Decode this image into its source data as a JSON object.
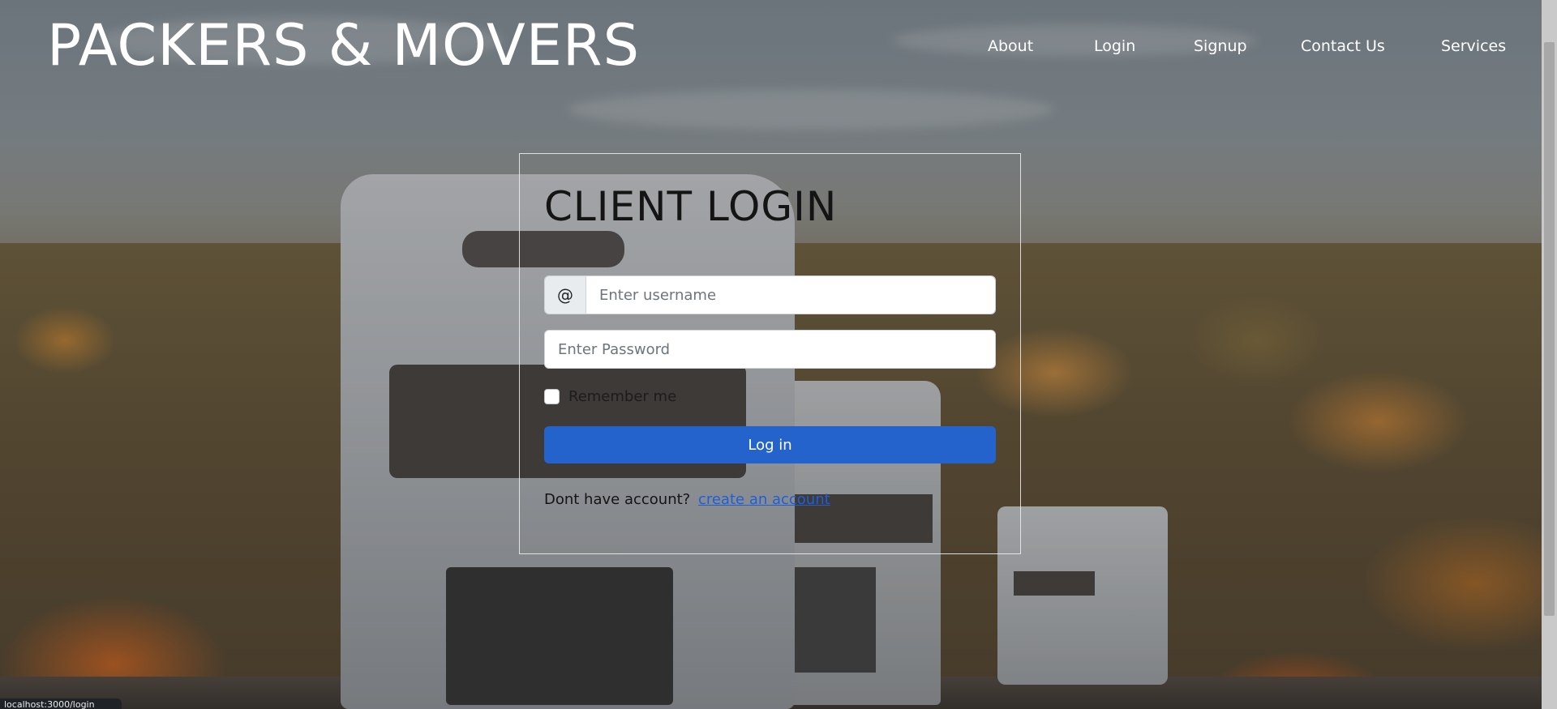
{
  "brand": {
    "logo_text": "PACKERS & MOVERS"
  },
  "nav": {
    "items": [
      {
        "label": "About"
      },
      {
        "label": "Login"
      },
      {
        "label": "Signup"
      },
      {
        "label": "Contact Us"
      },
      {
        "label": "Services"
      }
    ]
  },
  "login": {
    "title": "CLIENT LOGIN",
    "username_addon": "@",
    "username_placeholder": "Enter username",
    "password_placeholder": "Enter Password",
    "remember_label": "Remember me",
    "remember_checked": false,
    "submit_label": "Log in",
    "signup_prompt": "Dont have account?",
    "signup_link": "create an account"
  },
  "status_bar": {
    "url": "localhost:3000/login"
  },
  "colors": {
    "primary_button": "#2563cc",
    "link": "#1f5fd6",
    "heading": "#141414"
  }
}
